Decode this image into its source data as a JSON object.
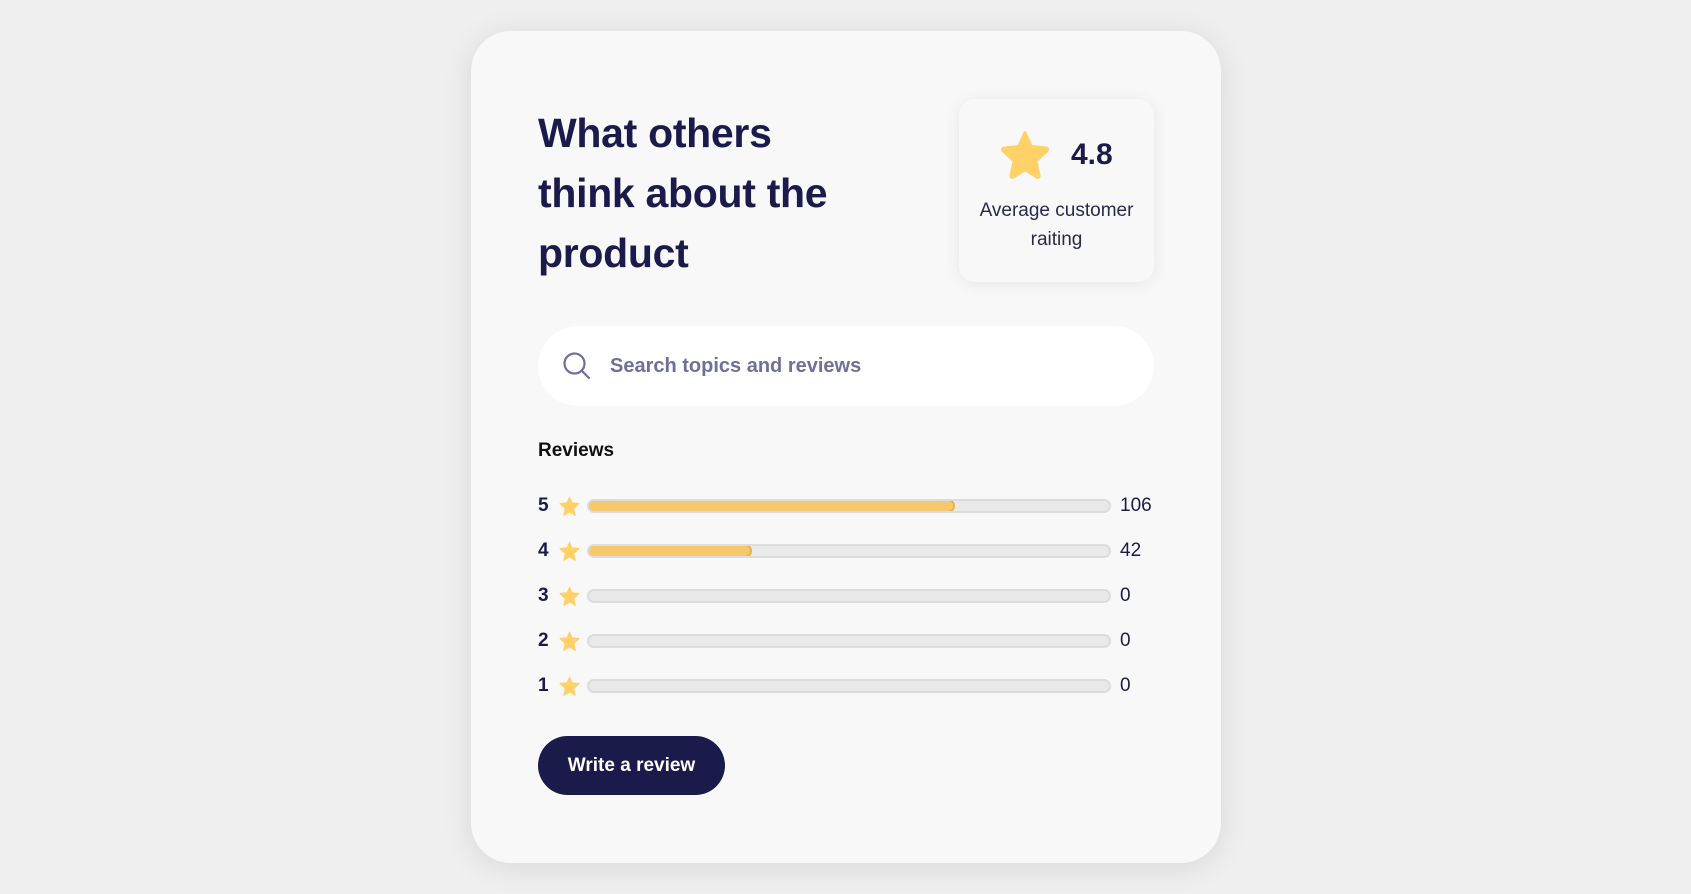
{
  "heading": "What others think about the product",
  "rating": {
    "value": "4.8",
    "label": "Average customer raiting",
    "icon": "star-icon",
    "color": "#ffd166"
  },
  "search": {
    "placeholder": "Search topics and reviews",
    "icon": "search-icon"
  },
  "reviews": {
    "title": "Reviews",
    "rows": [
      {
        "stars": "5",
        "count": "106",
        "fill_fraction": 0.7
      },
      {
        "stars": "4",
        "count": "42",
        "fill_fraction": 0.31
      },
      {
        "stars": "3",
        "count": "0",
        "fill_fraction": 0
      },
      {
        "stars": "2",
        "count": "0",
        "fill_fraction": 0
      },
      {
        "stars": "1",
        "count": "0",
        "fill_fraction": 0
      }
    ]
  },
  "write_button_label": "Write a review",
  "colors": {
    "primary": "#1b1b4b",
    "star": "#ffd166",
    "bar_fill": "#f6c86a",
    "bar_track": "#e9e9ea",
    "placeholder": "#6f6f9a"
  }
}
